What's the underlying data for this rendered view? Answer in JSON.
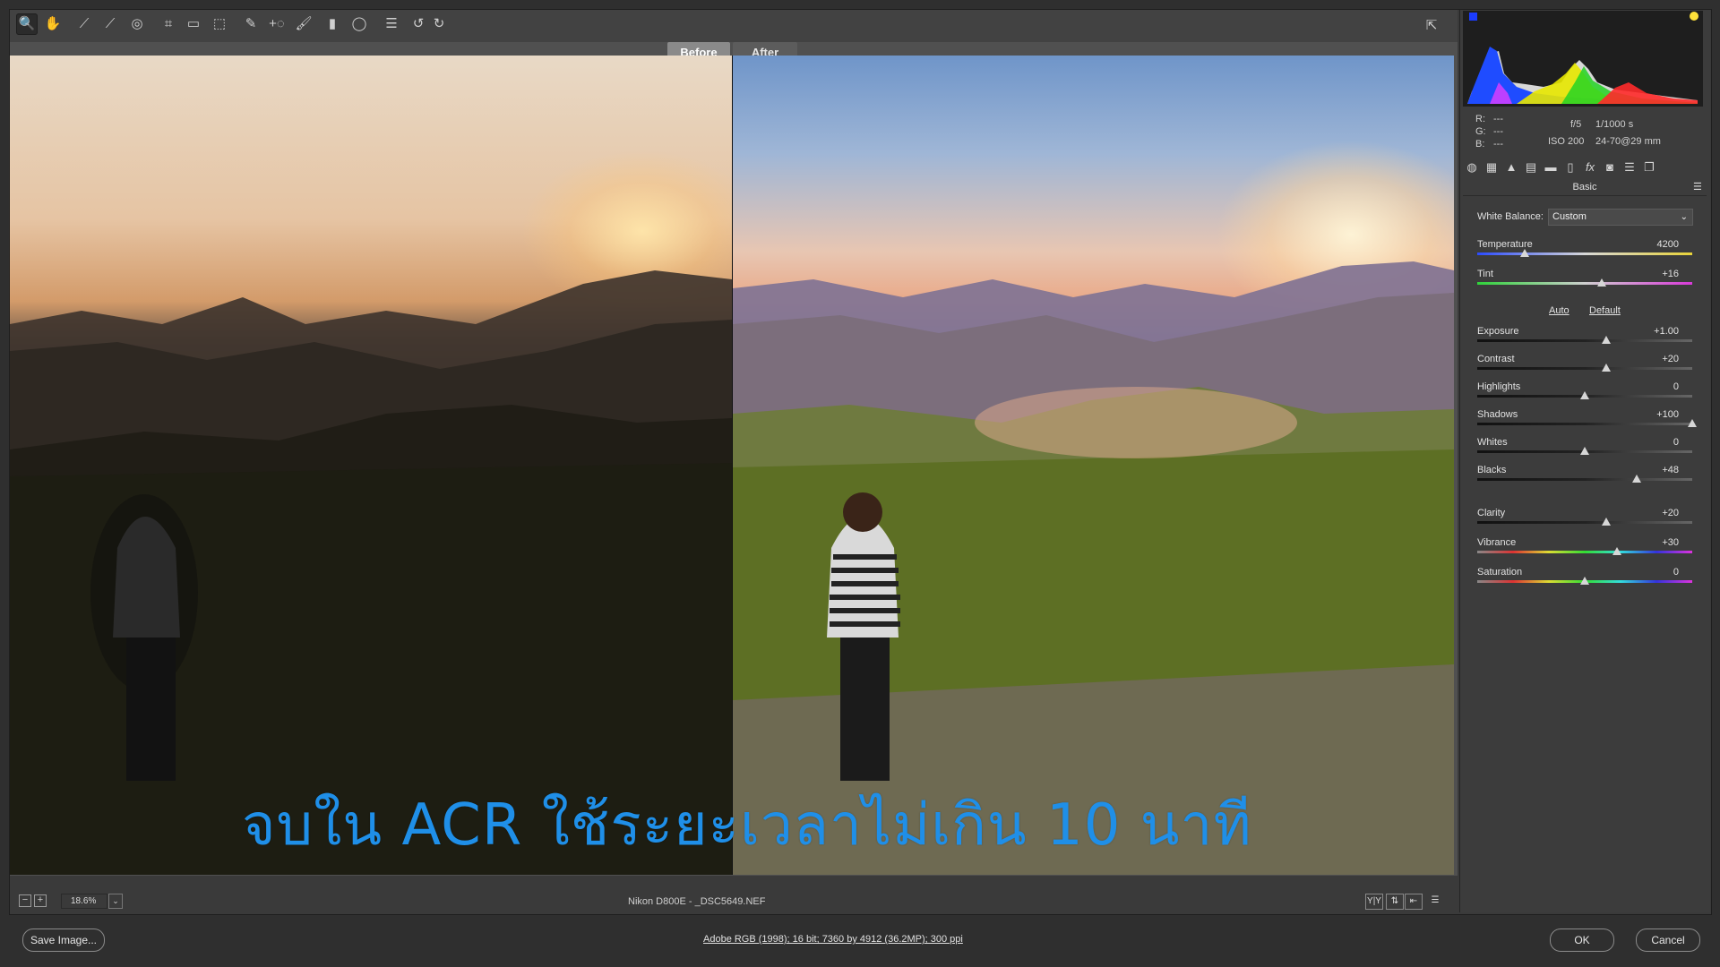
{
  "toolbar": {
    "tools": [
      {
        "name": "zoom-tool",
        "glyph": "🔍"
      },
      {
        "name": "hand-tool",
        "glyph": "✋"
      },
      {
        "name": "white-balance-tool",
        "glyph": "⟋"
      },
      {
        "name": "color-sampler-tool",
        "glyph": "⟋"
      },
      {
        "name": "targeted-adjustment-tool",
        "glyph": "◎"
      },
      {
        "name": "crop-tool",
        "glyph": "⌗"
      },
      {
        "name": "straighten-tool",
        "glyph": "▭"
      },
      {
        "name": "transform-tool",
        "glyph": "⬚"
      },
      {
        "name": "spot-removal-tool",
        "glyph": "✎"
      },
      {
        "name": "red-eye-tool",
        "glyph": "+◌"
      },
      {
        "name": "adjustment-brush-tool",
        "glyph": "🖌"
      },
      {
        "name": "graduated-filter-tool",
        "glyph": "▮"
      },
      {
        "name": "radial-filter-tool",
        "glyph": "◯"
      },
      {
        "name": "preferences-tool",
        "glyph": "☰"
      },
      {
        "name": "rotate-left-tool",
        "glyph": "↺"
      },
      {
        "name": "rotate-right-tool",
        "glyph": "↻"
      }
    ]
  },
  "preview": {
    "tab_before": "Before",
    "tab_after": "After",
    "caption": "จบใน ACR ใช้ระยะเวลาไม่เกิน 10 นาที"
  },
  "status": {
    "zoom": "18.6%",
    "filename": "Nikon D800E  -  _DSC5649.NEF"
  },
  "readout": {
    "r": "R:",
    "g": "G:",
    "b": "B:",
    "dash": "---",
    "aperture": "f/5",
    "shutter": "1/1000 s",
    "iso": "ISO 200",
    "lens": "24-70@29 mm"
  },
  "basic": {
    "header": "Basic",
    "white_balance_label": "White Balance:",
    "white_balance_value": "Custom",
    "auto": "Auto",
    "default": "Default",
    "sliders": [
      {
        "key": "temperature",
        "label": "Temperature",
        "value": "4200",
        "pos": 0.22,
        "track": "temp"
      },
      {
        "key": "tint",
        "label": "Tint",
        "value": "+16",
        "pos": 0.58,
        "track": "tint"
      },
      {
        "key": "exposure",
        "label": "Exposure",
        "value": "+1.00",
        "pos": 0.6,
        "track": "plain"
      },
      {
        "key": "contrast",
        "label": "Contrast",
        "value": "+20",
        "pos": 0.6,
        "track": "plain"
      },
      {
        "key": "highlights",
        "label": "Highlights",
        "value": "0",
        "pos": 0.5,
        "track": "plain"
      },
      {
        "key": "shadows",
        "label": "Shadows",
        "value": "+100",
        "pos": 1.0,
        "track": "plain"
      },
      {
        "key": "whites",
        "label": "Whites",
        "value": "0",
        "pos": 0.5,
        "track": "plain"
      },
      {
        "key": "blacks",
        "label": "Blacks",
        "value": "+48",
        "pos": 0.74,
        "track": "plain"
      },
      {
        "key": "clarity",
        "label": "Clarity",
        "value": "+20",
        "pos": 0.6,
        "track": "plain"
      },
      {
        "key": "vibrance",
        "label": "Vibrance",
        "value": "+30",
        "pos": 0.65,
        "track": "sat"
      },
      {
        "key": "saturation",
        "label": "Saturation",
        "value": "0",
        "pos": 0.5,
        "track": "sat"
      }
    ]
  },
  "footer": {
    "save": "Save Image...",
    "workflow": "Adobe RGB (1998); 16 bit; 7360 by 4912 (36.2MP); 300 ppi",
    "ok": "OK",
    "cancel": "Cancel"
  },
  "colors": {
    "caption": "#1f8fe8",
    "panel_bg": "#3c3c3c"
  }
}
